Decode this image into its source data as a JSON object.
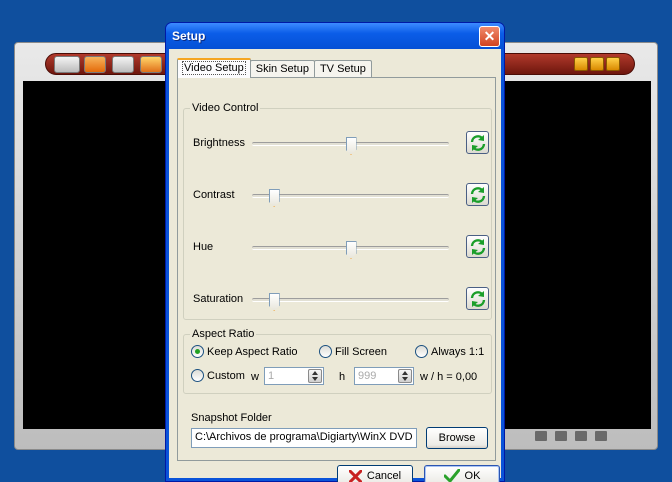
{
  "dialog": {
    "title": "Setup",
    "close_label": "✕"
  },
  "tabs": [
    {
      "label": "Video Setup",
      "active": true
    },
    {
      "label": "Skin Setup",
      "active": false
    },
    {
      "label": "TV Setup",
      "active": false
    }
  ],
  "video_control": {
    "group_label": "Video Control",
    "sliders": [
      {
        "label": "Brightness",
        "level_percent": 50
      },
      {
        "label": "Contrast",
        "level_percent": 11
      },
      {
        "label": "Hue",
        "level_percent": 50
      },
      {
        "label": "Saturation",
        "level_percent": 11
      }
    ]
  },
  "aspect_ratio": {
    "group_label": "Aspect Ratio",
    "options": {
      "keep": "Keep Aspect Ratio",
      "fill": "Fill Screen",
      "always": "Always 1:1",
      "custom": "Custom"
    },
    "selected": "keep",
    "w_label": "w",
    "h_label": "h",
    "w_value": "1",
    "h_value": "999",
    "ratio_text": "w / h = 0,00"
  },
  "snapshot": {
    "label": "Snapshot Folder",
    "path": "C:\\Archivos de programa\\Digiarty\\WinX DVD",
    "browse_label": "Browse"
  },
  "buttons": {
    "cancel": "Cancel",
    "ok": "OK"
  },
  "colors": {
    "titlebar": "#0550d5",
    "dialog_bg": "#ece9d8",
    "reset_icon": "#1a9e2a",
    "cancel_icon": "#c82222",
    "ok_icon": "#2aa12a"
  }
}
